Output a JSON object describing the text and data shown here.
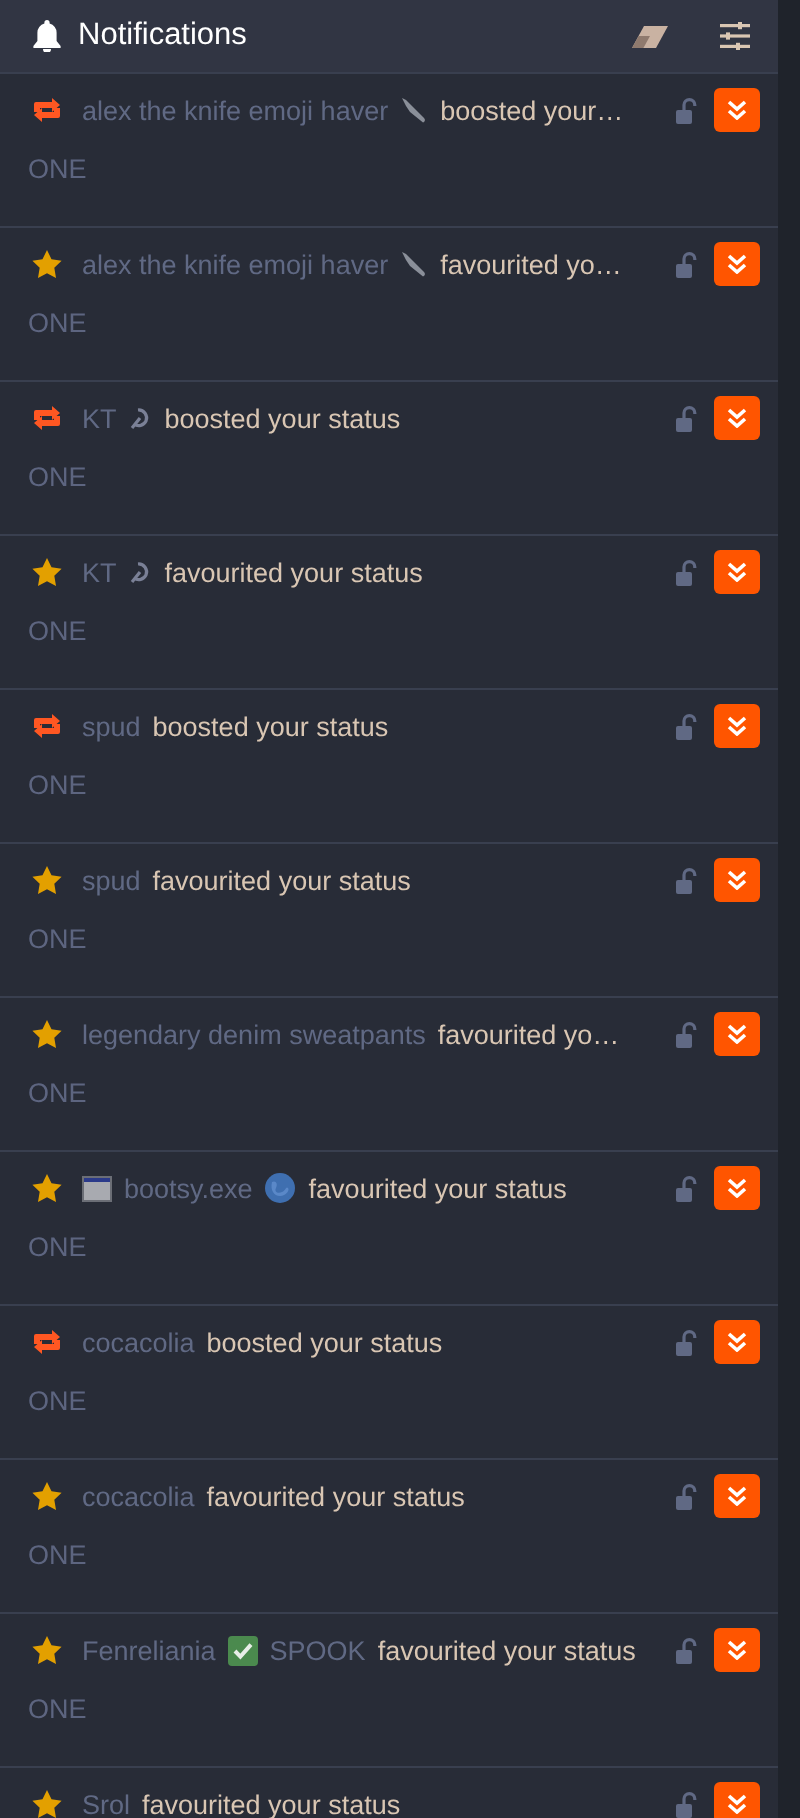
{
  "header": {
    "title": "Notifications"
  },
  "notifications": [
    {
      "kind": "boost",
      "account": [
        {
          "kind": "text",
          "text": "alex the knife emoji haver"
        },
        {
          "kind": "knife"
        }
      ],
      "action": "boosted your…",
      "body": "ONE"
    },
    {
      "kind": "favourite",
      "account": [
        {
          "kind": "text",
          "text": "alex the knife emoji haver"
        },
        {
          "kind": "knife"
        }
      ],
      "action": "favourited yo…",
      "body": "ONE"
    },
    {
      "kind": "boost",
      "account": [
        {
          "kind": "text",
          "text": "KT"
        },
        {
          "kind": "sickle"
        }
      ],
      "action": "boosted your status",
      "body": "ONE"
    },
    {
      "kind": "favourite",
      "account": [
        {
          "kind": "text",
          "text": "KT"
        },
        {
          "kind": "sickle"
        }
      ],
      "action": "favourited your status",
      "body": "ONE"
    },
    {
      "kind": "boost",
      "account": [
        {
          "kind": "text",
          "text": "spud"
        }
      ],
      "action": "boosted your status",
      "body": "ONE"
    },
    {
      "kind": "favourite",
      "account": [
        {
          "kind": "text",
          "text": "spud"
        }
      ],
      "action": "favourited your status",
      "body": "ONE"
    },
    {
      "kind": "favourite",
      "account": [
        {
          "kind": "text",
          "text": "legendary denim sweatpants"
        }
      ],
      "action": "favourited yo…",
      "body": "ONE"
    },
    {
      "kind": "favourite",
      "account": [
        {
          "kind": "window"
        },
        {
          "kind": "text",
          "text": "bootsy.exe"
        },
        {
          "kind": "globe"
        }
      ],
      "action": "favourited your status",
      "body": "ONE"
    },
    {
      "kind": "boost",
      "account": [
        {
          "kind": "text",
          "text": "cocacolia"
        }
      ],
      "action": "boosted your status",
      "body": "ONE"
    },
    {
      "kind": "favourite",
      "account": [
        {
          "kind": "text",
          "text": "cocacolia"
        }
      ],
      "action": "favourited your status",
      "body": "ONE"
    },
    {
      "kind": "favourite",
      "account": [
        {
          "kind": "text",
          "text": "Fenreliania"
        },
        {
          "kind": "check"
        },
        {
          "kind": "text",
          "text": "SPOOK"
        }
      ],
      "action": "favourited your status",
      "body": "ONE"
    },
    {
      "kind": "favourite",
      "account": [
        {
          "kind": "text",
          "text": "Srol"
        }
      ],
      "action": "favourited your status"
    }
  ]
}
